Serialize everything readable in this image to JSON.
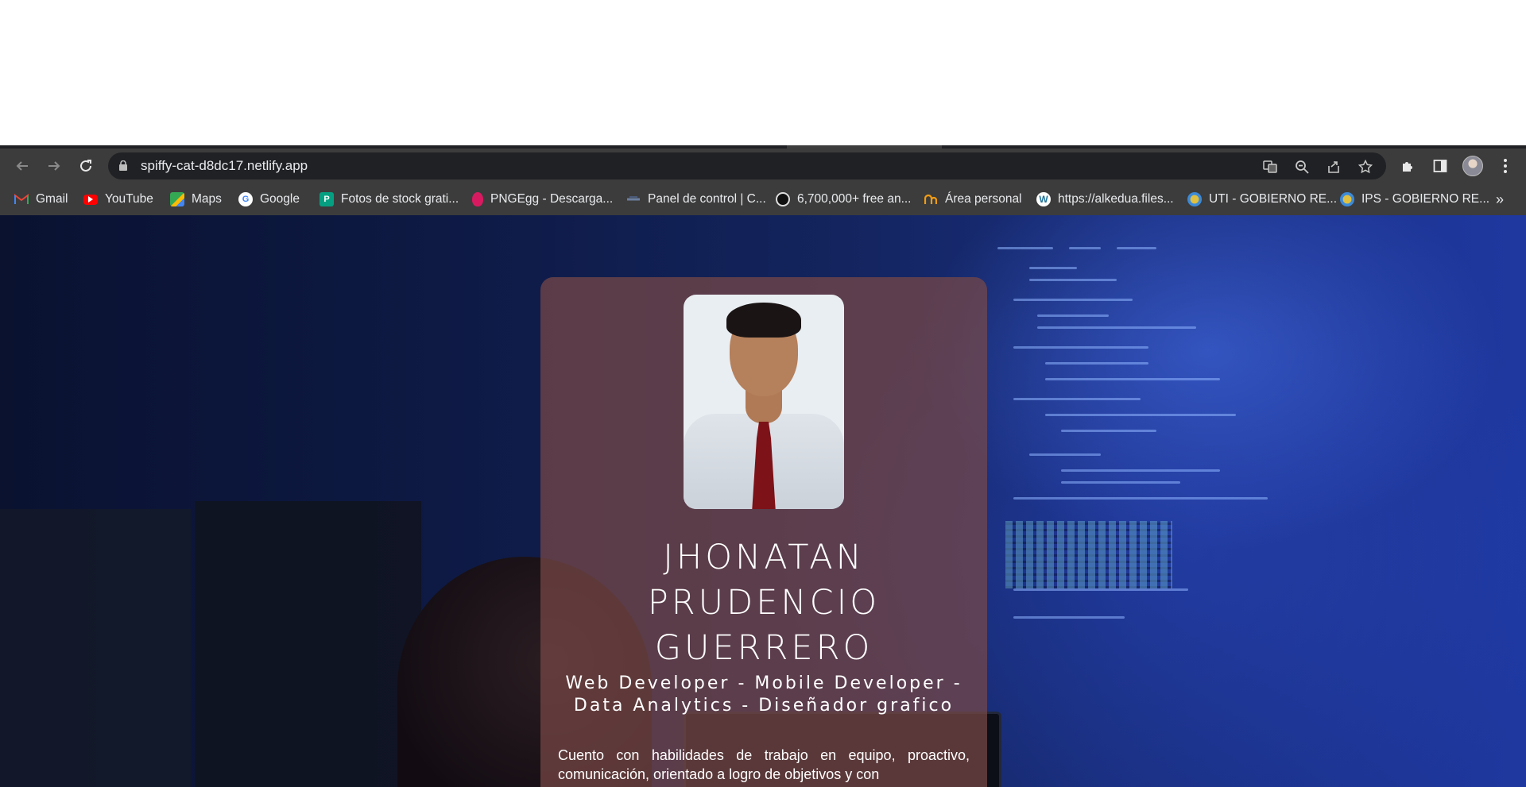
{
  "browser": {
    "url": "spiffy-cat-d8dc17.netlify.app",
    "bookmarks": [
      {
        "label": "Gmail",
        "icon": "gmail-icon",
        "color": "#ea4335"
      },
      {
        "label": "YouTube",
        "icon": "youtube-icon",
        "color": "#ff0000"
      },
      {
        "label": "Maps",
        "icon": "maps-icon",
        "color": "#34a853"
      },
      {
        "label": "Google",
        "icon": "google-icon",
        "color": "#ffffff"
      },
      {
        "label": "Fotos de stock grati...",
        "icon": "pexels-icon",
        "color": "#05a081"
      },
      {
        "label": "PNGEgg - Descarga...",
        "icon": "pngegg-icon",
        "color": "#d81b60"
      },
      {
        "label": "Panel de control | C...",
        "icon": "panel-icon",
        "color": "#6b7fa0"
      },
      {
        "label": "6,700,000+ free an...",
        "icon": "freepik-icon",
        "color": "#222222"
      },
      {
        "label": "Área personal",
        "icon": "area-personal-icon",
        "color": "#f39c12"
      },
      {
        "label": "https://alkedua.files...",
        "icon": "wordpress-icon",
        "color": "#21759b"
      },
      {
        "label": "UTI - GOBIERNO RE...",
        "icon": "gobierno-icon",
        "color": "#e0c040"
      },
      {
        "label": "IPS - GOBIERNO RE...",
        "icon": "gobierno-icon",
        "color": "#e0c040"
      }
    ],
    "more": "»"
  },
  "profile": {
    "name_line1": "JHONATAN",
    "name_line2": "PRUDENCIO",
    "name_line3": "GUERRERO",
    "role_line1": "Web Developer - Mobile Developer -",
    "role_line2": "Data Analytics - Diseñador grafico",
    "description": "Cuento con habilidades de trabajo en equipo, proactivo, comunicación, orientado a logro de objetivos y con"
  }
}
